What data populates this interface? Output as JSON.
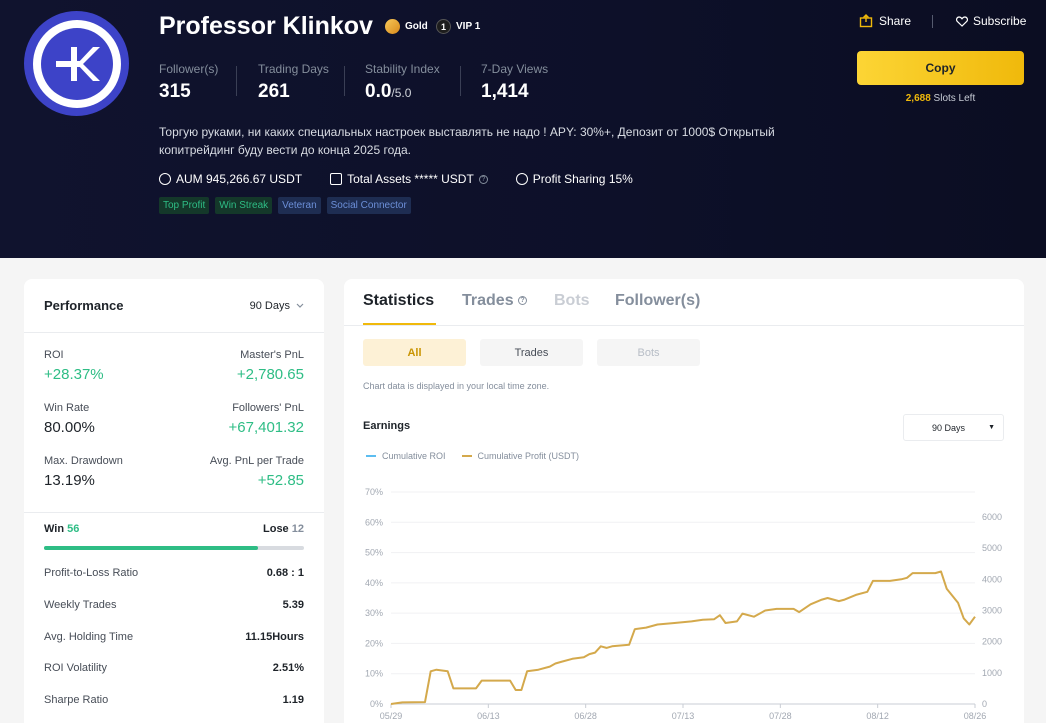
{
  "profile": {
    "name": "Professor Klinkov",
    "badges": {
      "gold": "Gold",
      "vip": "VIP 1",
      "vip_num": "1"
    },
    "stats": [
      {
        "label": "Follower(s)",
        "value": "315",
        "suffix": ""
      },
      {
        "label": "Trading Days",
        "value": "261",
        "suffix": ""
      },
      {
        "label": "Stability Index",
        "value": "0.0",
        "suffix": "/5.0"
      },
      {
        "label": "7-Day Views",
        "value": "1,414",
        "suffix": ""
      }
    ],
    "description": "Торгую руками, ни каких специальных настроек выставлять не надо ! APY: 30%+, Депозит от 1000$ Открытый копитрейдинг буду вести до конца 2025 года.",
    "aum": "AUM 945,266.67 USDT",
    "total_assets": "Total Assets ***** USDT",
    "profit_sharing": "Profit Sharing 15%",
    "tags": [
      "Top Profit",
      "Win Streak",
      "Veteran",
      "Social Connector"
    ]
  },
  "actions": {
    "share": "Share",
    "subscribe": "Subscribe",
    "copy": "Copy",
    "slots_num": "2,688",
    "slots_text": "Slots Left"
  },
  "performance": {
    "title": "Performance",
    "period": "90 Days",
    "roi_label": "ROI",
    "roi": "+28.37%",
    "master_pnl_label": "Master's PnL",
    "master_pnl": "+2,780.65",
    "win_rate_label": "Win Rate",
    "win_rate": "80.00%",
    "followers_pnl_label": "Followers' PnL",
    "followers_pnl": "+67,401.32",
    "drawdown_label": "Max. Drawdown",
    "drawdown": "13.19%",
    "avg_pnl_label": "Avg. PnL per Trade",
    "avg_pnl": "+52.85",
    "win_label": "Win",
    "win": "56",
    "lose_label": "Lose",
    "lose": "12",
    "win_fraction": 0.8235,
    "rows": [
      {
        "k": "Profit-to-Loss Ratio",
        "v": "0.68 : 1"
      },
      {
        "k": "Weekly Trades",
        "v": "5.39"
      },
      {
        "k": "Avg. Holding Time",
        "v": "11.15Hours"
      },
      {
        "k": "ROI Volatility",
        "v": "2.51%"
      },
      {
        "k": "Sharpe Ratio",
        "v": "1.19"
      }
    ]
  },
  "tabs": {
    "statistics": "Statistics",
    "trades": "Trades",
    "bots": "Bots",
    "followers": "Follower(s)"
  },
  "subtabs": {
    "all": "All",
    "trades": "Trades",
    "bots": "Bots"
  },
  "note": "Chart data is displayed in your local time zone.",
  "earnings": {
    "title": "Earnings",
    "range": "90 Days",
    "legend_roi": "Cumulative ROI",
    "legend_profit": "Cumulative Profit (USDT)"
  },
  "colors": {
    "roi": "#5cbdf0",
    "profit": "#d4a94c",
    "accent": "#f0b90b",
    "green": "#2ebd85"
  },
  "chart_data": {
    "type": "line",
    "x_ticks": [
      "05/29",
      "06/13",
      "06/28",
      "07/13",
      "07/28",
      "08/12",
      "08/26"
    ],
    "y_left_ticks": [
      "0%",
      "10%",
      "20%",
      "30%",
      "40%",
      "50%",
      "60%",
      "70%"
    ],
    "y_right_ticks": [
      "0",
      "1000",
      "2000",
      "3000",
      "4000",
      "5000",
      "6000"
    ],
    "y_right_range": [
      0,
      6000
    ],
    "series": [
      {
        "name": "Cumulative Profit (USDT)",
        "axis": "right",
        "points": [
          [
            0,
            0
          ],
          [
            2,
            50
          ],
          [
            6,
            60
          ],
          [
            7,
            1050
          ],
          [
            8,
            1100
          ],
          [
            10,
            1050
          ],
          [
            11,
            500
          ],
          [
            15,
            500
          ],
          [
            16,
            750
          ],
          [
            21,
            750
          ],
          [
            22,
            450
          ],
          [
            23,
            450
          ],
          [
            24,
            1050
          ],
          [
            26,
            1100
          ],
          [
            28,
            1200
          ],
          [
            29,
            1300
          ],
          [
            30,
            1350
          ],
          [
            32,
            1450
          ],
          [
            34,
            1500
          ],
          [
            35,
            1600
          ],
          [
            36,
            1650
          ],
          [
            37,
            1850
          ],
          [
            38,
            1800
          ],
          [
            39,
            1850
          ],
          [
            42,
            1900
          ],
          [
            43,
            2400
          ],
          [
            45,
            2450
          ],
          [
            47,
            2550
          ],
          [
            50,
            2600
          ],
          [
            53,
            2650
          ],
          [
            55,
            2700
          ],
          [
            57,
            2720
          ],
          [
            58,
            2850
          ],
          [
            59,
            2600
          ],
          [
            61,
            2650
          ],
          [
            62,
            2900
          ],
          [
            64,
            2800
          ],
          [
            66,
            3000
          ],
          [
            68,
            3050
          ],
          [
            71,
            3050
          ],
          [
            72,
            2950
          ],
          [
            74,
            3200
          ],
          [
            76,
            3350
          ],
          [
            77,
            3400
          ],
          [
            79,
            3300
          ],
          [
            80,
            3350
          ],
          [
            82,
            3500
          ],
          [
            84,
            3600
          ],
          [
            85,
            3950
          ],
          [
            87,
            3950
          ],
          [
            88,
            3950
          ],
          [
            90,
            4000
          ],
          [
            91,
            4050
          ],
          [
            92,
            4200
          ],
          [
            96,
            4200
          ],
          [
            97,
            4250
          ],
          [
            98,
            3700
          ],
          [
            100,
            3250
          ],
          [
            101,
            2750
          ],
          [
            102,
            2550
          ],
          [
            103,
            2800
          ]
        ]
      }
    ]
  }
}
